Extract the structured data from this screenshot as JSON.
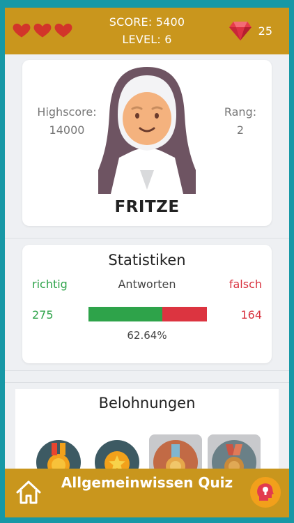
{
  "header": {
    "lives": 3,
    "score": "SCORE: 5400",
    "level": "LEVEL: 6",
    "gems": "25"
  },
  "profile": {
    "highscore_label": "Highscore:",
    "highscore_value": "14000",
    "rank_label": "Rang:",
    "rank_value": "2",
    "name": "FRITZE"
  },
  "stats": {
    "title": "Statistiken",
    "correct_label": "richtig",
    "answers_label": "Antworten",
    "wrong_label": "falsch",
    "correct_value": "275",
    "wrong_value": "164",
    "correct_ratio": 0.6264,
    "percent": "62.64%"
  },
  "rewards": {
    "title": "Belohnungen",
    "badges": [
      {
        "icon": "gold-medal-icon",
        "locked": false
      },
      {
        "icon": "gold-star-badge-icon",
        "locked": false
      },
      {
        "icon": "bronze-medal-icon",
        "locked": true
      },
      {
        "icon": "bronze-medal-ribbon-icon",
        "locked": true
      }
    ]
  },
  "footer": {
    "brand": "Allgemeinwissen Quiz"
  },
  "colors": {
    "bar_gold": "#c9961d",
    "frame_teal": "#1798a6",
    "correct_green": "#2ea34a",
    "wrong_red": "#d8313e"
  }
}
